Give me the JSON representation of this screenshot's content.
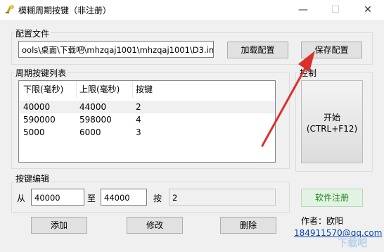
{
  "window": {
    "title": "模糊周期按键（非注册）",
    "controls": {
      "minimize": "—",
      "maximize": "☐",
      "close": "✕"
    }
  },
  "config": {
    "group_label": "配置文件",
    "path_value": "ools\\桌面\\下载吧\\mhzqaj1001\\mhzqaj1001\\D3.ini",
    "load_label": "加载配置",
    "save_label": "保存配置"
  },
  "list": {
    "group_label": "周期按键列表",
    "columns": [
      "下限(毫秒)",
      "上限(毫秒)",
      "按键"
    ],
    "rows": [
      [
        "40000",
        "44000",
        "2"
      ],
      [
        "590000",
        "598000",
        "4"
      ],
      [
        "5000",
        "6000",
        "3"
      ]
    ],
    "selected_row": 0
  },
  "control": {
    "group_label": "控制",
    "start_label": "开始",
    "start_hotkey": "(CTRL+F12)",
    "register_label": "软件注册"
  },
  "edit": {
    "group_label": "按键编辑",
    "from_label": "从",
    "from_value": "40000",
    "to_label": "至",
    "to_value": "44000",
    "key_label": "按",
    "key_value": "2",
    "add_label": "添加",
    "modify_label": "修改",
    "delete_label": "删除"
  },
  "footer": {
    "author": "作者：欧阳",
    "contact": "184911570@qq.com"
  },
  "colors": {
    "arrow": "#d9312a",
    "focus_border": "#0078d7",
    "link": "#0645ad",
    "register_text": "#1e8a1e"
  }
}
